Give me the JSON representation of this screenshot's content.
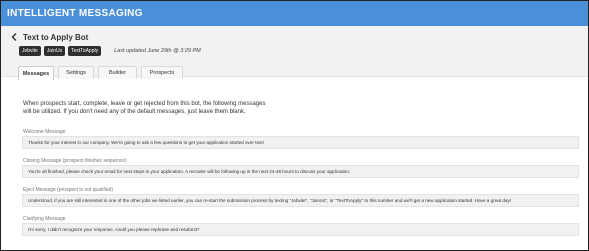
{
  "app": {
    "title": "INTELLIGENT MESSAGING"
  },
  "page": {
    "title": "Text to Apply Bot",
    "tags": [
      "Jobvite",
      "JoinUs",
      "TextToApply"
    ],
    "last_updated": "Last updated June 29th @ 3:29 PM"
  },
  "tabs": [
    {
      "label": "Messages",
      "active": true
    },
    {
      "label": "Settings",
      "active": false
    },
    {
      "label": "Builder",
      "active": false
    },
    {
      "label": "Prospects",
      "active": false
    }
  ],
  "intro": {
    "line1": "When prospects start, complete, leave or get rejected from this bot, the following messages",
    "line2": "will be utilized. If you don't need any of the default messages, just leave them blank."
  },
  "messages": [
    {
      "label": "Welcome Message",
      "text": "Thanks for your interest in our company. We're going to ask a few questions to get your application started over text!"
    },
    {
      "label": "Closing Message (prospect finishes sequence)",
      "text": "You're all finished, please check your email for next steps in your application. A recruiter will be following up in the next 24-48 hours to discuss your application."
    },
    {
      "label": "Eject Message (prospect is not qualified)",
      "text": "Understood, if you are still interested in one of the other jobs we listed earlier, you can re-start the submission process by texting \"Jobvite\", \"JoinUs\", or \"TextToApply\" to this number and we'll get a new application started. Have a great day!"
    },
    {
      "label": "Clarifying Message",
      "text": "I'm sorry, I didn't recognize your response, could you please rephrase and resubmit?"
    }
  ],
  "colors": {
    "header": "#4a90d9",
    "tag_bg": "#2f2f2f",
    "panel_bg": "#f2f2f2"
  },
  "icons": {
    "back": "chevron-left-icon"
  }
}
